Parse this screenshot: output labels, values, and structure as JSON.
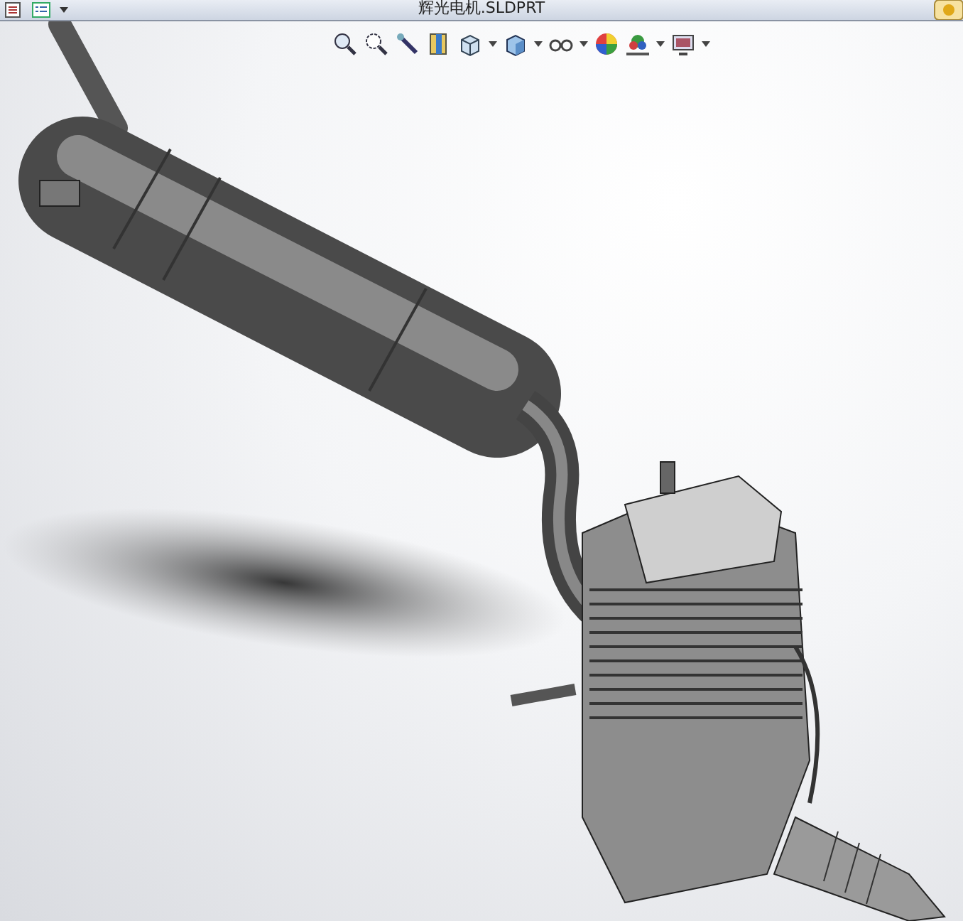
{
  "window": {
    "title": "辉光电机.SLDPRT"
  }
}
